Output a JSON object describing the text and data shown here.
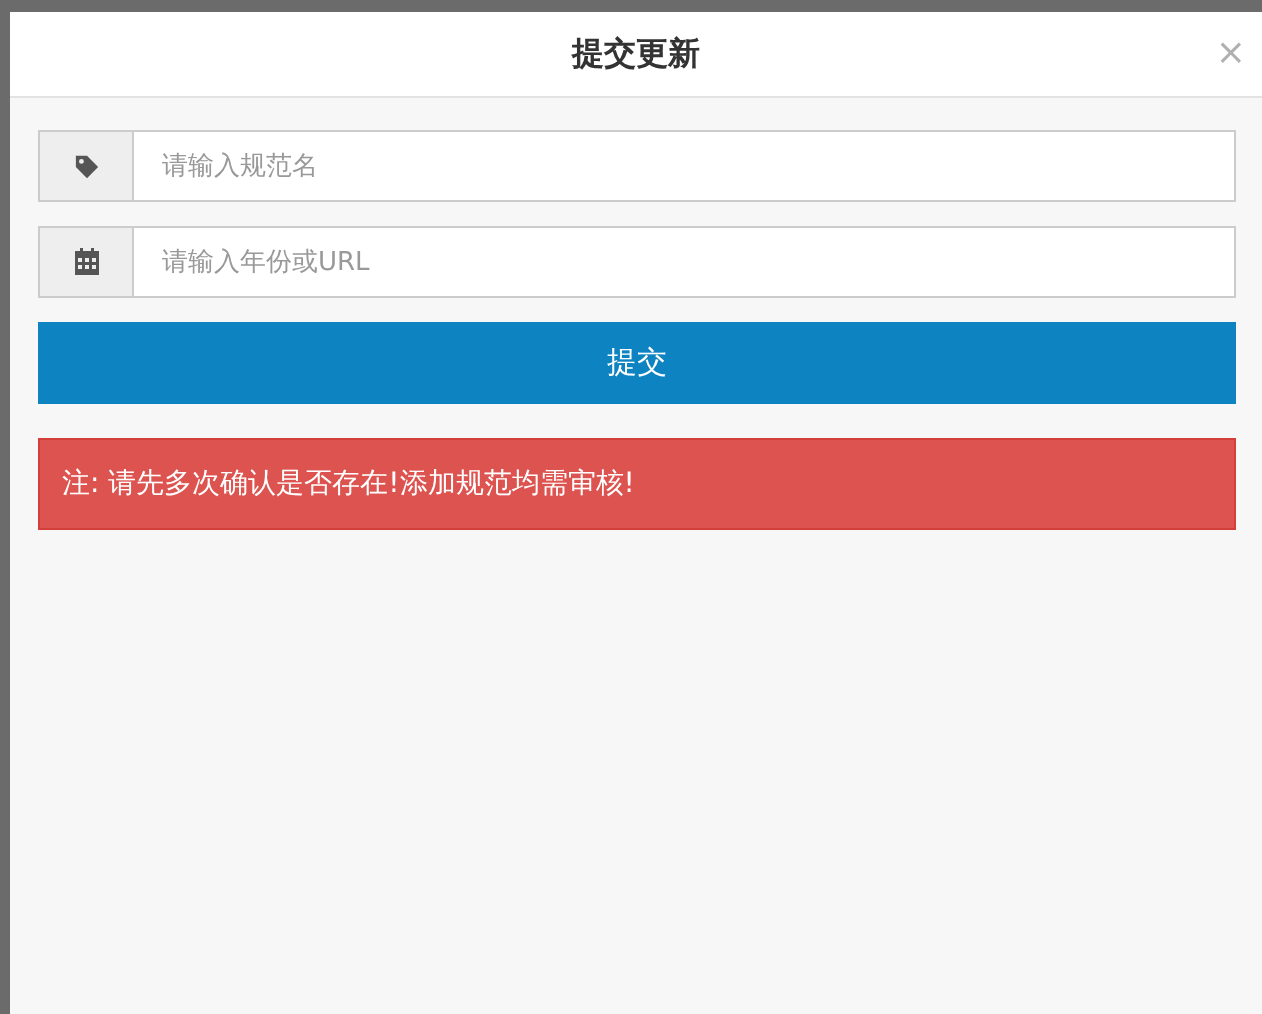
{
  "modal": {
    "title": "提交更新",
    "close": "×"
  },
  "fields": [
    {
      "kind": "tag",
      "placeholder": "请输入规范名"
    },
    {
      "kind": "calendar",
      "placeholder": "请输入年份或URL"
    }
  ],
  "submit_button": "提交",
  "alert": "注: 请先多次确认是否存在!添加规范均需审核!"
}
